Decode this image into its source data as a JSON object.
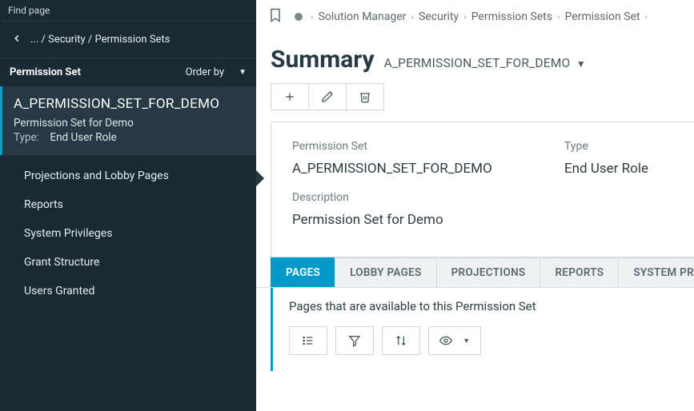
{
  "sidebar": {
    "find_page": "Find page",
    "breadcrumb_text": "... / Security / Permission Sets",
    "list_title": "Permission Set",
    "order_by": "Order by",
    "card": {
      "title": "A_PERMISSION_SET_FOR_DEMO",
      "subtitle": "Permission Set for Demo",
      "type_label": "Type:",
      "type_value": "End User Role"
    },
    "nav": [
      "Projections and Lobby Pages",
      "Reports",
      "System Privileges",
      "Grant Structure",
      "Users Granted"
    ]
  },
  "main": {
    "breadcrumbs": [
      "Solution Manager",
      "Security",
      "Permission Sets",
      "Permission Set"
    ],
    "heading": "Summary",
    "entity": "A_PERMISSION_SET_FOR_DEMO",
    "fields": {
      "permission_set_label": "Permission Set",
      "permission_set_value": "A_PERMISSION_SET_FOR_DEMO",
      "type_label": "Type",
      "type_value": "End User Role",
      "description_label": "Description",
      "description_value": "Permission Set for Demo"
    },
    "tabs": [
      "PAGES",
      "LOBBY PAGES",
      "PROJECTIONS",
      "REPORTS",
      "SYSTEM PRIVI"
    ],
    "tab_desc": "Pages that are available to this Permission Set"
  }
}
